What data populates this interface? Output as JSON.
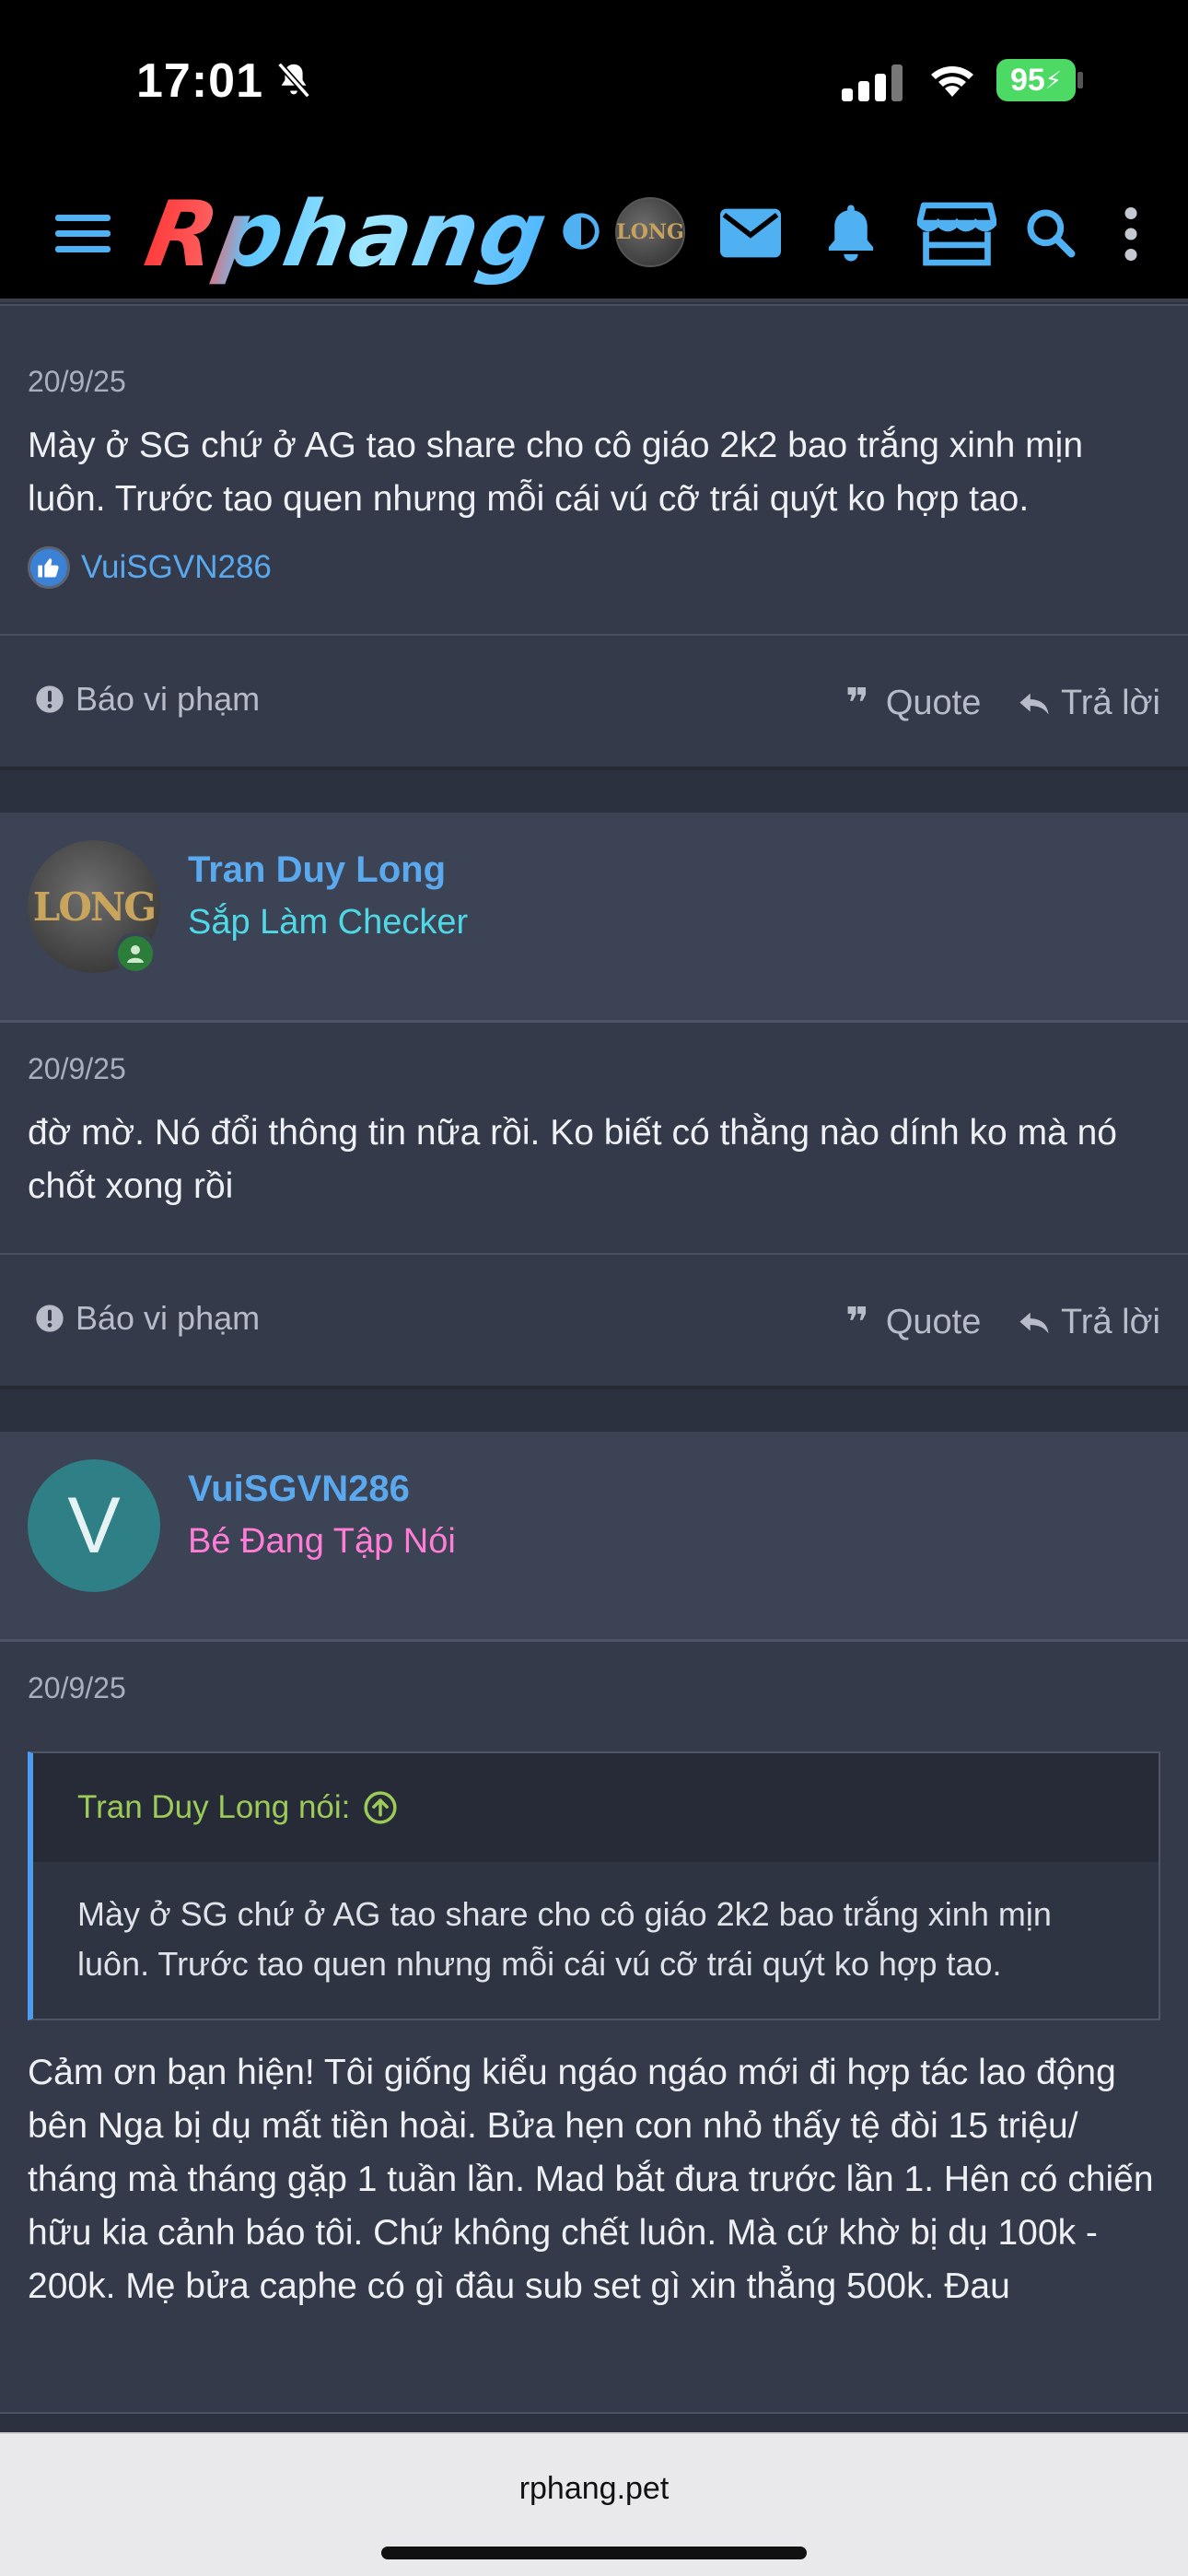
{
  "status_bar": {
    "time": "17:01",
    "battery": "95"
  },
  "header": {
    "logo_text": "Rphang",
    "avatar_text": "LONG"
  },
  "posts": [
    {
      "date": "20/9/25",
      "text": "Mày ở SG chứ ở AG tao share cho cô giáo 2k2 bao trắng xinh mịn luôn. Trước tao quen nhưng mỗi cái vú cỡ trái quýt ko hợp tao.",
      "reaction_user": "VuiSGVN286",
      "report_label": "Báo vi phạm",
      "quote_label": "Quote",
      "reply_label": "Trả lời"
    },
    {
      "user_name": "Tran Duy Long",
      "user_title": "Sắp Làm Checker",
      "user_title_color": "#4fd8e6",
      "avatar_text": "LONG",
      "date": "20/9/25",
      "text": "đờ mờ. Nó đổi thông tin nữa rồi. Ko biết có thằng nào dính ko mà nó chốt xong rồi",
      "report_label": "Báo vi phạm",
      "quote_label": "Quote",
      "reply_label": "Trả lời"
    },
    {
      "user_name": "VuiSGVN286",
      "user_title": "Bé Đang Tập Nói",
      "user_title_color": "#ff7dd6",
      "avatar_letter": "V",
      "date": "20/9/25",
      "quote_author": "Tran Duy Long nói:",
      "quote_text": "Mày ở SG chứ ở AG tao share cho cô giáo 2k2 bao trắng xinh mịn luôn. Trước tao quen nhưng mỗi cái vú cỡ trái quýt ko hợp tao.",
      "text": "Cảm ơn bạn hiện! Tôi giống kiểu ngáo ngáo mới đi hợp tác lao động bên Nga bị dụ mất tiền hoài. Bửa hẹn con nhỏ thấy tệ đòi 15 triệu/ tháng mà tháng gặp 1 tuần lần. Mad bắt đưa trước lần 1. Hên có chiến hữu kia cảnh báo tôi. Chứ không chết luôn. Mà cứ khờ bị dụ 100k - 200k. Mẹ bửa caphe có gì đâu sub set gì xin thẳng 500k. Đau"
    }
  ],
  "browser": {
    "url": "rphang.pet"
  },
  "colors": {
    "link_blue": "#5aa9ef",
    "quote_green": "#9ccb58",
    "avatar_teal": "#2f7f86"
  }
}
